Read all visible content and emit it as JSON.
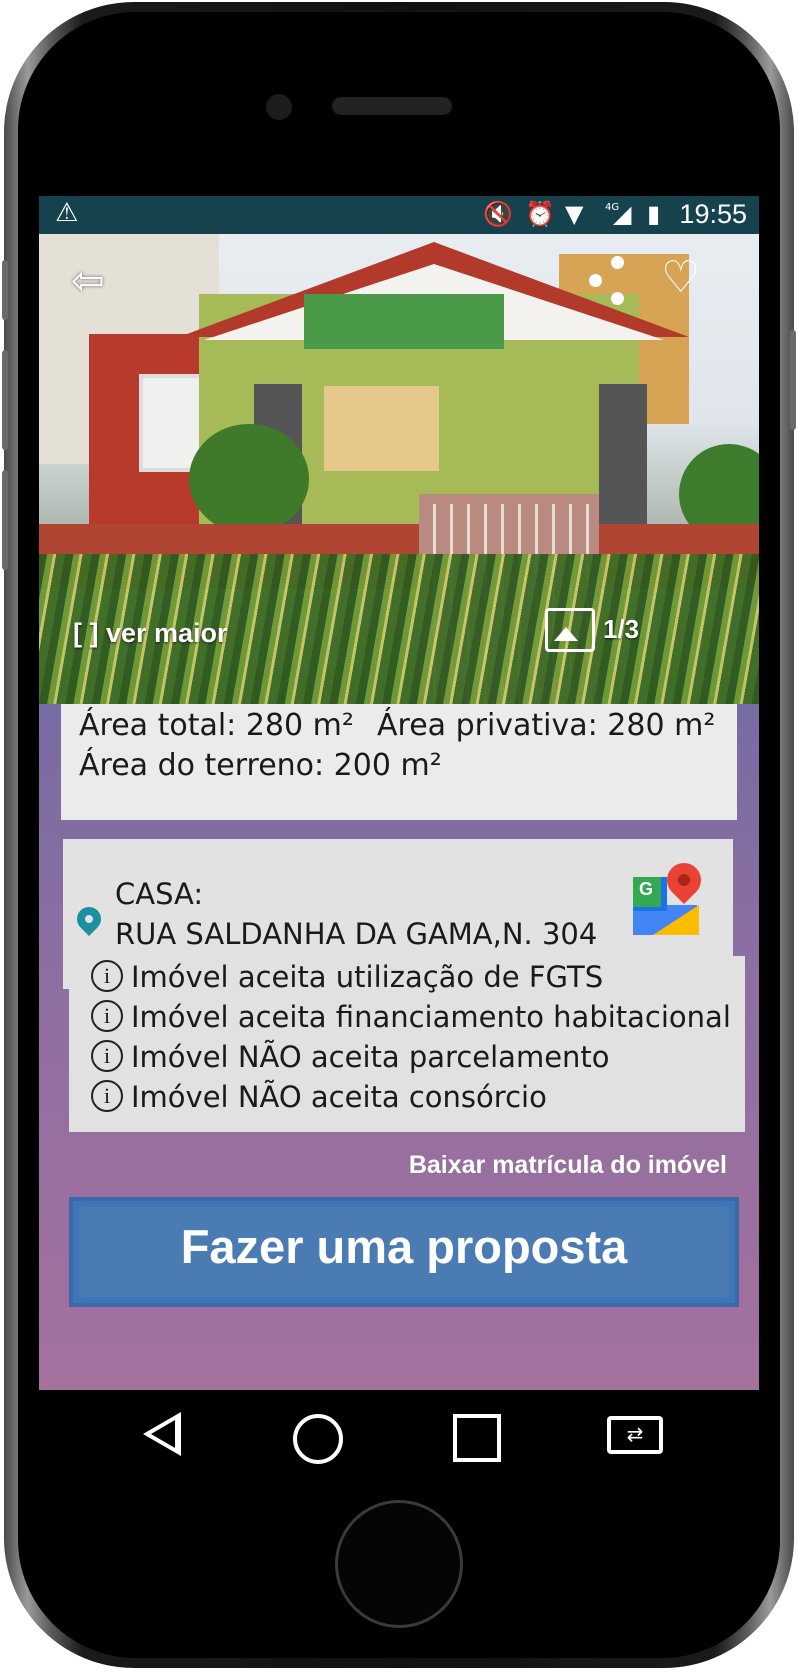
{
  "statusbar": {
    "alert_icon": "warning-icon",
    "icons": [
      "mute-icon",
      "alarm-icon",
      "wifi-icon",
      "signal-4g-icon",
      "battery-icon"
    ],
    "network_label": "4G",
    "time": "19:55"
  },
  "hero": {
    "back_icon": "back-arrow-icon",
    "share_icon": "share-icon",
    "favorite_icon": "heart-icon",
    "expand_label": "[ ] ver maior",
    "gallery_icon": "gallery-icon",
    "photo_counter": "1/3"
  },
  "area": {
    "total": "Área total: 280 m²",
    "privativa": "Área privativa: 280 m²",
    "terreno": "Área do terreno: 200 m²"
  },
  "address": {
    "pin_icon": "location-pin-icon",
    "type": "CASA:",
    "street": "RUA SALDANHA DA GAMA,N. 304",
    "maps_icon": "google-maps-icon"
  },
  "features": [
    {
      "icon": "info-icon",
      "text": "Imóvel aceita utilização de FGTS"
    },
    {
      "icon": "info-icon",
      "text": "Imóvel aceita financiamento habitacional"
    },
    {
      "icon": "info-icon",
      "text": "Imóvel NÃO aceita parcelamento"
    },
    {
      "icon": "info-icon",
      "text": "Imóvel NÃO aceita consórcio"
    }
  ],
  "download_link": "Baixar matrícula do imóvel",
  "cta_label": "Fazer uma proposta",
  "navbar": {
    "back": "nav-back-icon",
    "home": "nav-home-icon",
    "recent": "nav-recent-icon",
    "switch": "nav-switch-icon"
  },
  "colors": {
    "statusbar": "#16424e",
    "cta": "#3e76b8",
    "gradient_top": "#4a66a8",
    "gradient_bottom": "#a4719d",
    "pin": "#1e8fa0"
  }
}
